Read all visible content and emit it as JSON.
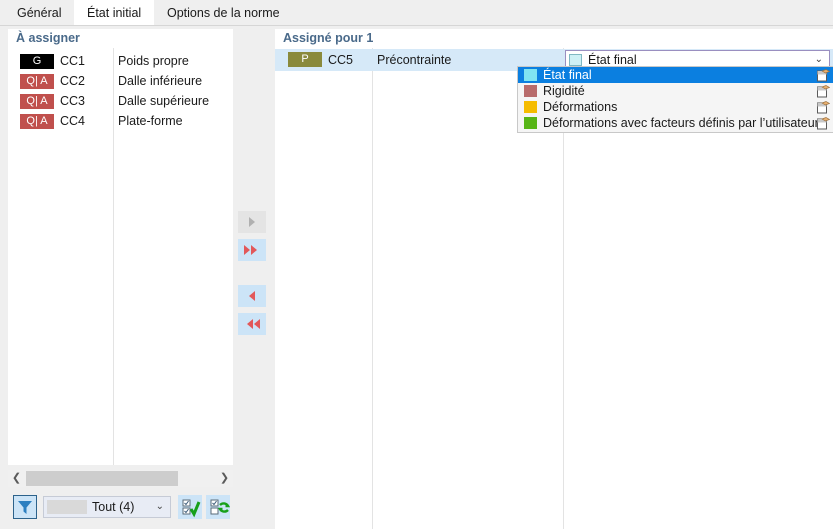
{
  "tabs": [
    {
      "label": "Général",
      "active": false
    },
    {
      "label": "État initial",
      "active": true
    },
    {
      "label": "Options de la norme",
      "active": false
    }
  ],
  "left_panel": {
    "header": "À assigner",
    "rows": [
      {
        "badge": "G",
        "badge_type": "g",
        "code": "CC1",
        "description": "Poids propre"
      },
      {
        "badge": "Q| A",
        "badge_type": "qa",
        "code": "CC2",
        "description": "Dalle inférieure"
      },
      {
        "badge": "Q| A",
        "badge_type": "qa",
        "code": "CC3",
        "description": "Dalle supérieure"
      },
      {
        "badge": "Q| A",
        "badge_type": "qa",
        "code": "CC4",
        "description": "Plate-forme"
      }
    ]
  },
  "transfer_buttons": [
    {
      "name": "move-right-one",
      "glyph": "▶",
      "enabled": false
    },
    {
      "name": "move-right-all",
      "glyph": "▶▶",
      "enabled": true
    },
    {
      "name": "move-left-one",
      "glyph": "◀",
      "enabled": true
    },
    {
      "name": "move-left-all",
      "glyph": "◀◀",
      "enabled": true
    }
  ],
  "right_panel": {
    "header": "Assigné pour 1",
    "row": {
      "badge": "P",
      "badge_type": "p",
      "code": "CC5",
      "description": "Précontrainte"
    },
    "combo": {
      "value": "État final",
      "swatch_color": "#cdf0f5",
      "caret": "⌄"
    }
  },
  "dropdown": {
    "items": [
      {
        "label": "État final",
        "color": "#7fe4f2",
        "selected": true
      },
      {
        "label": "Rigidité",
        "color": "#b86b6b",
        "selected": false
      },
      {
        "label": "Déformations",
        "color": "#f5bc00",
        "selected": false
      },
      {
        "label": "Déformations avec facteurs définis par l’utilisateur",
        "color": "#57b516",
        "selected": false
      }
    ]
  },
  "scrollbar": {
    "left_arrow": "❮",
    "right_arrow": "❯"
  },
  "filter_bar": {
    "filter_icon": "filter-funnel-icon",
    "combo_value": "Tout (4)",
    "caret": "⌄",
    "select_all_icon": "check-all-icon",
    "invert_selection_icon": "invert-selection-icon"
  }
}
